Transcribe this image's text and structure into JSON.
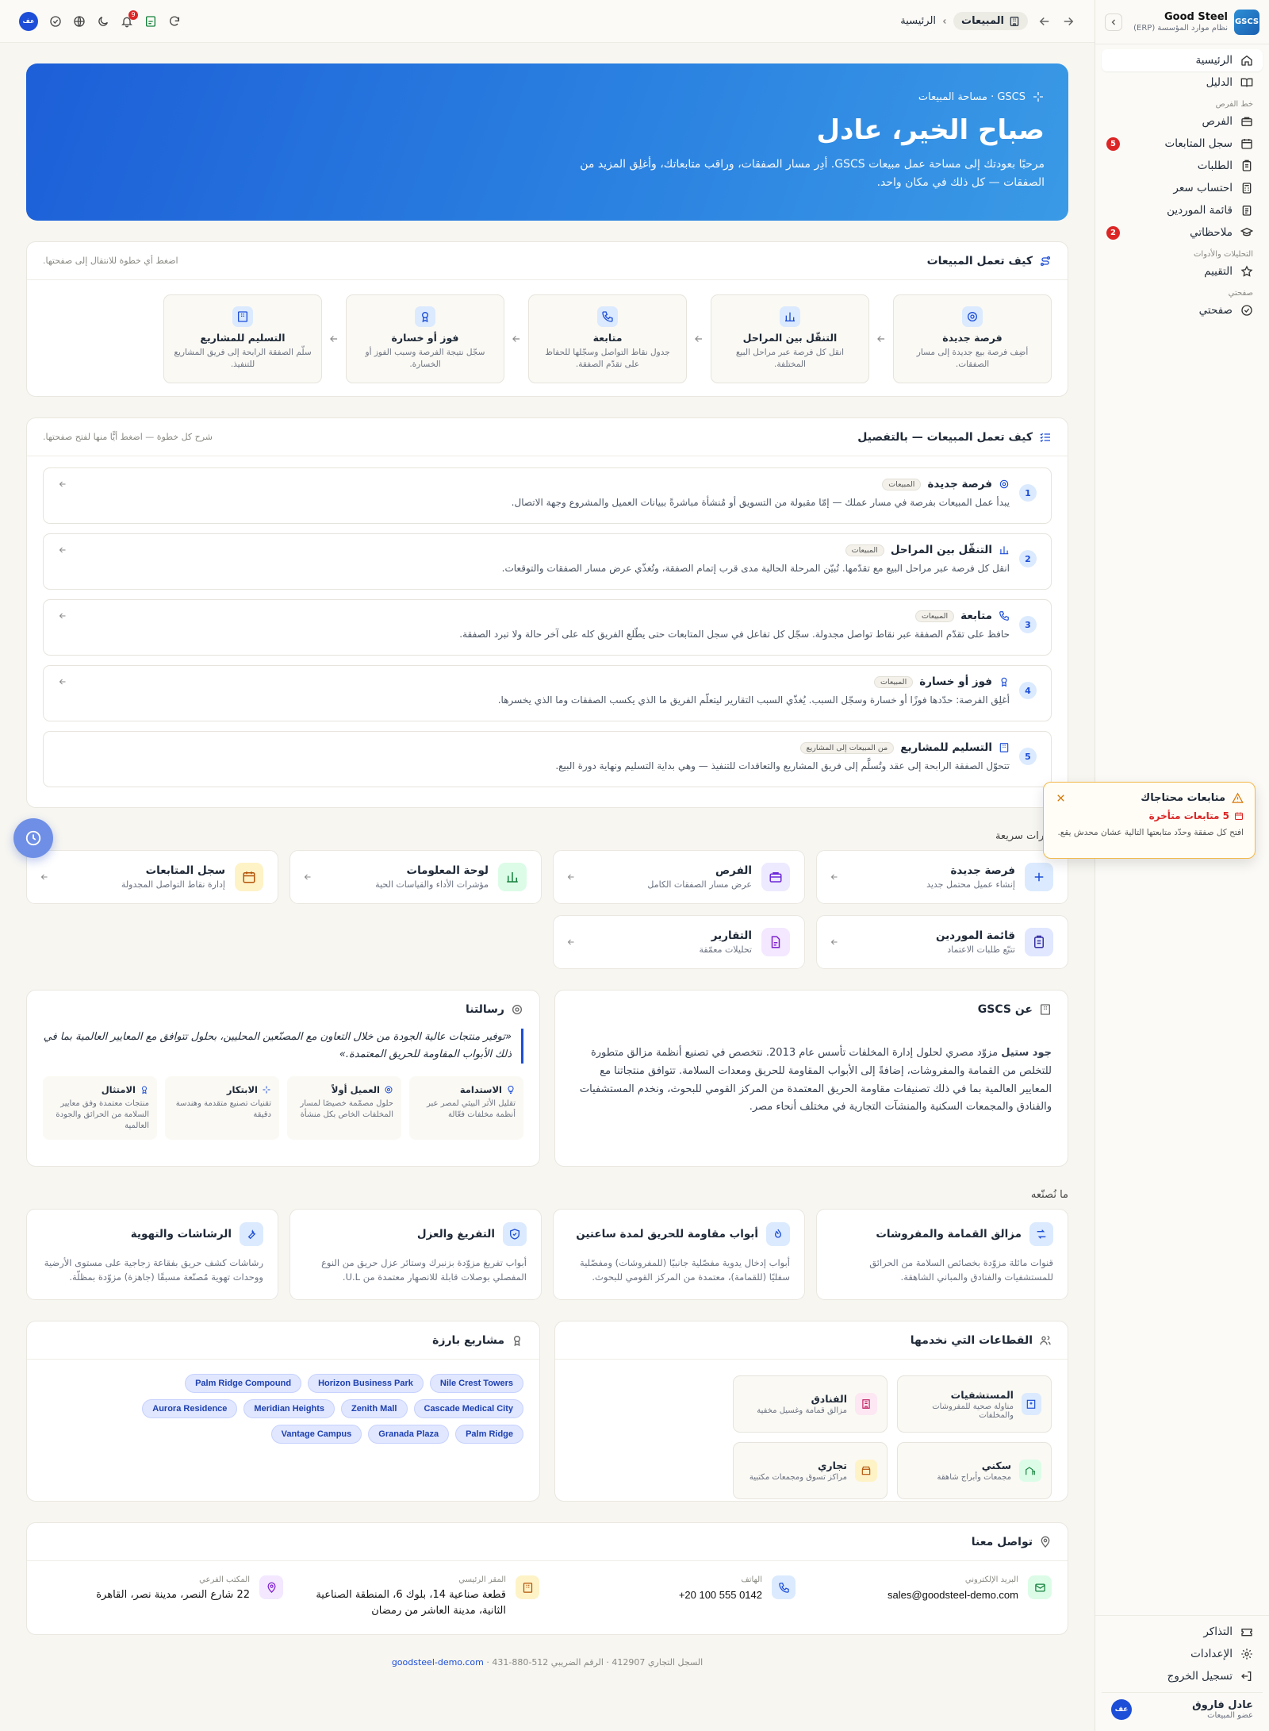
{
  "brand": {
    "logo": "GSCS",
    "name": "Good Steel",
    "subtitle": "نظام موارد المؤسسة (ERP)"
  },
  "sidebar": {
    "items": [
      {
        "label": "الرئيسية",
        "icon": "home-icon",
        "active": true
      },
      {
        "label": "الدليل",
        "icon": "book-icon"
      }
    ],
    "group_sales": "خط الفرص",
    "sales_items": [
      {
        "label": "الفرص",
        "icon": "briefcase-icon"
      },
      {
        "label": "سجل المتابعات",
        "icon": "calendar-icon",
        "badge": "5"
      },
      {
        "label": "الطلبات",
        "icon": "clipboard-icon"
      },
      {
        "label": "احتساب سعر",
        "icon": "calculator-icon"
      },
      {
        "label": "قائمة الموردين",
        "icon": "list-icon"
      },
      {
        "label": "ملاحظاتي",
        "icon": "cap-icon",
        "badge": "2"
      }
    ],
    "group_analytics": "التحليلات والأدوات",
    "analytics_items": [
      {
        "label": "التقييم",
        "icon": "star-icon"
      }
    ],
    "group_page": "صفحتي",
    "page_items": [
      {
        "label": "صفحتي",
        "icon": "check-circle-icon"
      }
    ],
    "bottom_items": [
      {
        "label": "التذاكر",
        "icon": "ticket-icon"
      },
      {
        "label": "الإعدادات",
        "icon": "gear-icon"
      },
      {
        "label": "تسجيل الخروج",
        "icon": "logout-icon"
      }
    ],
    "user": {
      "initials": "عف",
      "name": "عادل فاروق",
      "role": "عضو المبيعات"
    }
  },
  "topbar": {
    "home": "الرئيسية",
    "current": "المبيعات",
    "notif_count": "9",
    "avatar": "عف"
  },
  "hero": {
    "tag": "GSCS · مساحة المبيعات",
    "title": "صباح الخير، عادل",
    "subtitle": "مرحبًا بعودتك إلى مساحة عمل مبيعات GSCS. أدِر مسار الصفقات، وراقب متابعاتك، وأغلِق المزيد من الصفقات — كل ذلك في مكان واحد."
  },
  "flow": {
    "title": "كيف تعمل المبيعات",
    "hint": "اضغط أي خطوة للانتقال إلى صفحتها.",
    "steps": [
      {
        "title": "فرصة جديدة",
        "desc": "أضِف فرصة بيع جديدة إلى مسار الصفقات."
      },
      {
        "title": "التنقّل بين المراحل",
        "desc": "انقل كل فرصة عبر مراحل البيع المختلفة."
      },
      {
        "title": "متابعة",
        "desc": "جدول نقاط التواصل وسجّلها للحفاظ على تقدّم الصفقة."
      },
      {
        "title": "فوز أو خسارة",
        "desc": "سجّل نتيجة الفرصة وسبب الفوز أو الخسارة."
      },
      {
        "title": "التسليم للمشاريع",
        "desc": "سلّم الصفقة الرابحة إلى فريق المشاريع للتنفيذ."
      }
    ]
  },
  "detail": {
    "title": "كيف تعمل المبيعات — بالتفصيل",
    "hint": "شرح كل خطوة — اضغط أيًّا منها لفتح صفحتها.",
    "steps": [
      {
        "num": "1",
        "title": "فرصة جديدة",
        "tag": "المبيعات",
        "desc": "يبدأ عمل المبيعات بفرصة في مسار عملك — إمّا مقبولة من التسويق أو مُنشأة مباشرةً ببيانات العميل والمشروع وجهة الاتصال."
      },
      {
        "num": "2",
        "title": "التنقّل بين المراحل",
        "tag": "المبيعات",
        "desc": "انقل كل فرصة عبر مراحل البيع مع تقدّمها. تُبيّن المرحلة الحالية مدى قرب إتمام الصفقة، وتُغذّي عرض مسار الصفقات والتوقعات."
      },
      {
        "num": "3",
        "title": "متابعة",
        "tag": "المبيعات",
        "desc": "حافظ على تقدّم الصفقة عبر نقاط تواصل مجدولة. سجّل كل تفاعل في سجل المتابعات حتى يطّلع الفريق كله على آخر حالة ولا تبرد الصفقة."
      },
      {
        "num": "4",
        "title": "فوز أو خسارة",
        "tag": "المبيعات",
        "desc": "أغلِق الفرصة: حدّدها فوزًا أو خسارة وسجّل السبب. يُغذّي السبب التقارير ليتعلّم الفريق ما الذي يكسب الصفقات وما الذي يخسرها."
      },
      {
        "num": "5",
        "title": "التسليم للمشاريع",
        "tag": "من المبيعات إلى المشاريع",
        "desc": "تتحوّل الصفقة الرابحة إلى عقد وتُسلَّم إلى فريق المشاريع والتعاقدات للتنفيذ — وهي بداية التسليم ونهاية دورة البيع."
      }
    ]
  },
  "quick": {
    "label": "اختصارات سريعة",
    "items": [
      {
        "title": "فرصة جديدة",
        "desc": "إنشاء عميل محتمل جديد",
        "color": "#dbeafe",
        "fg": "#1d4ed8",
        "icon": "plus-icon"
      },
      {
        "title": "الفرص",
        "desc": "عرض مسار الصفقات الكامل",
        "color": "#ede9fe",
        "fg": "#6d28d9",
        "icon": "briefcase-icon"
      },
      {
        "title": "لوحة المعلومات",
        "desc": "مؤشرات الأداء والقياسات الحية",
        "color": "#dcfce7",
        "fg": "#15803d",
        "icon": "chart-icon"
      },
      {
        "title": "سجل المتابعات",
        "desc": "إدارة نقاط التواصل المجدولة",
        "color": "#fef3c7",
        "fg": "#b45309",
        "icon": "calendar-icon"
      },
      {
        "title": "قائمة الموردين",
        "desc": "تتبّع طلبات الاعتماد",
        "color": "#e0e7ff",
        "fg": "#3730a3",
        "icon": "clipboard-icon"
      },
      {
        "title": "التقارير",
        "desc": "تحليلات معمّقة",
        "color": "#f3e8ff",
        "fg": "#7e22ce",
        "icon": "file-icon"
      }
    ]
  },
  "about": {
    "title": "عن GSCS",
    "company": "جود ستيل",
    "body": "مزوّد مصري لحلول إدارة المخلفات تأسس عام 2013. نتخصص في تصنيع أنظمة مزالق متطورة للتخلص من القمامة والمفروشات، إضافةً إلى الأبواب المقاومة للحريق ومعدات السلامة. تتوافق منتجاتنا مع المعايير العالمية بما في ذلك تصنيفات مقاومة الحريق المعتمدة من المركز القومي للبحوث، ونخدم المستشفيات والفنادق والمجمعات السكنية والمنشآت التجارية في مختلف أنحاء مصر."
  },
  "mission": {
    "title": "رسالتنا",
    "quote": "«توفير منتجات عالية الجودة من خلال التعاون مع المصنّعين المحليين، بحلول تتوافق مع المعايير العالمية بما في ذلك الأبواب المقاومة للحريق المعتمدة.»",
    "values": [
      {
        "title": "الاستدامة",
        "desc": "تقليل الأثر البيئي لمصر عبر أنظمة مخلفات فعّالة"
      },
      {
        "title": "العميل أولاً",
        "desc": "حلول مصمّمة خصيصًا لمسار المخلفات الخاص بكل منشأة"
      },
      {
        "title": "الابتكار",
        "desc": "تقنيات تصنيع متقدمة وهندسة دقيقة"
      },
      {
        "title": "الامتثال",
        "desc": "منتجات معتمدة وفق معايير السلامة من الحرائق والجودة العالمية"
      }
    ]
  },
  "products": {
    "label": "ما نُصنّعه",
    "items": [
      {
        "title": "مزالق القمامة والمفروشات",
        "desc": "قنوات مائلة مزوّدة بخصائص السلامة من الحرائق للمستشفيات والفنادق والمباني الشاهقة."
      },
      {
        "title": "أبواب مقاومة للحريق لمدة ساعتين",
        "desc": "أبواب إدخال يدوية مفصّلية جانبيًا (للمفروشات) ومفصّلية سفليًا (للقمامة)، معتمدة من المركز القومي للبحوث."
      },
      {
        "title": "التفريغ والعزل",
        "desc": "أبواب تفريغ مزوّدة بزنبرك وستائر عزل حريق من النوع المفصلي بوصلات قابلة للانصهار معتمدة من U.L."
      },
      {
        "title": "الرشاشات والتهوية",
        "desc": "رشاشات كشف حريق بفقاعة زجاجية على مستوى الأرضية ووحدات تهوية مُصنّعة مسبقًا (جاهزة) مزوّدة بمظلّة."
      }
    ]
  },
  "sectors": {
    "title": "القطاعات التي نخدمها",
    "items": [
      {
        "title": "المستشفيات",
        "desc": "مناولة صحية للمفروشات والمخلفات",
        "color": "#dbeafe",
        "fg": "#1d4ed8"
      },
      {
        "title": "الفنادق",
        "desc": "مزالق قمامة وغسيل مخفية",
        "color": "#fce7f3",
        "fg": "#be185d"
      },
      {
        "title": "سكني",
        "desc": "مجمعات وأبراج شاهقة",
        "color": "#dcfce7",
        "fg": "#15803d"
      },
      {
        "title": "تجاري",
        "desc": "مراكز تسوق ومجمعات مكتبية",
        "color": "#fef3c7",
        "fg": "#b45309"
      }
    ]
  },
  "projects": {
    "title": "مشاريع بارزة",
    "items": [
      "Nile Crest Towers",
      "Horizon Business Park",
      "Palm Ridge Compound",
      "Cascade Medical City",
      "Zenith Mall",
      "Meridian Heights",
      "Aurora Residence",
      "Palm Ridge",
      "Granada Plaza",
      "Vantage Campus"
    ]
  },
  "contact": {
    "title": "تواصل معنا",
    "items": [
      {
        "label": "البريد الإلكتروني",
        "value": "sales@goodsteel-demo.com",
        "color": "#dcfce7",
        "fg": "#15803d",
        "icon": "mail-icon"
      },
      {
        "label": "الهاتف",
        "value": "+20 100 555 0142",
        "color": "#dbeafe",
        "fg": "#1d4ed8",
        "icon": "phone-icon"
      },
      {
        "label": "المقر الرئيسي",
        "value": "قطعة صناعية 14، بلوك 6، المنطقة الصناعية الثانية، مدينة العاشر من رمضان",
        "color": "#fef3c7",
        "fg": "#b45309",
        "icon": "building-icon"
      },
      {
        "label": "المكتب الفرعي",
        "value": "22 شارع النصر، مدينة نصر، القاهرة",
        "color": "#f3e8ff",
        "fg": "#7e22ce",
        "icon": "pin-icon"
      }
    ]
  },
  "footer": {
    "text": "السجل التجاري 412907 · الرقم الضريبي 512-880-431 · ",
    "link": "goodsteel-demo.com"
  },
  "toast": {
    "title": "متابعات محتاجاك",
    "count_text": "5 متابعات متأخرة",
    "desc": "افتح كل صفقة وحدّد متابعتها التالية عشان محدش يقع."
  }
}
